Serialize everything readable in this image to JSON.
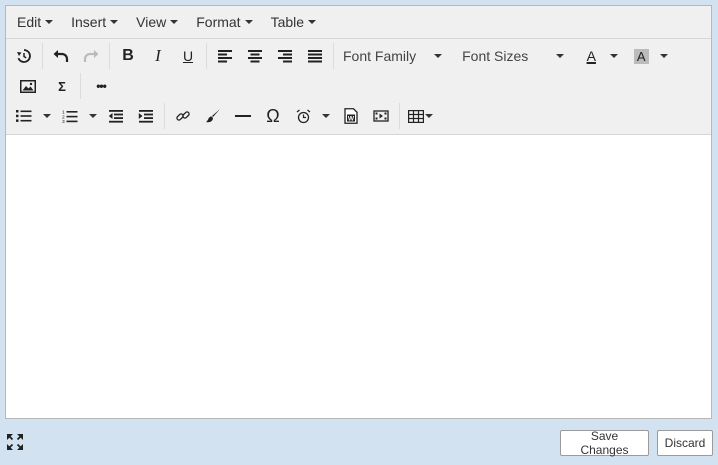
{
  "menubar": {
    "items": [
      {
        "label": "Edit"
      },
      {
        "label": "Insert"
      },
      {
        "label": "View"
      },
      {
        "label": "Format"
      },
      {
        "label": "Table"
      }
    ]
  },
  "toolbar": {
    "bold": "B",
    "italic": "I",
    "underline": "U",
    "font_family": "Font Family",
    "font_sizes": "Font Sizes",
    "text_color": "A",
    "bg_color": "A",
    "formula": "Σ",
    "more": "•••",
    "omega": "Ω"
  },
  "footer": {
    "save_label": "Save Changes",
    "discard_label": "Discard"
  }
}
